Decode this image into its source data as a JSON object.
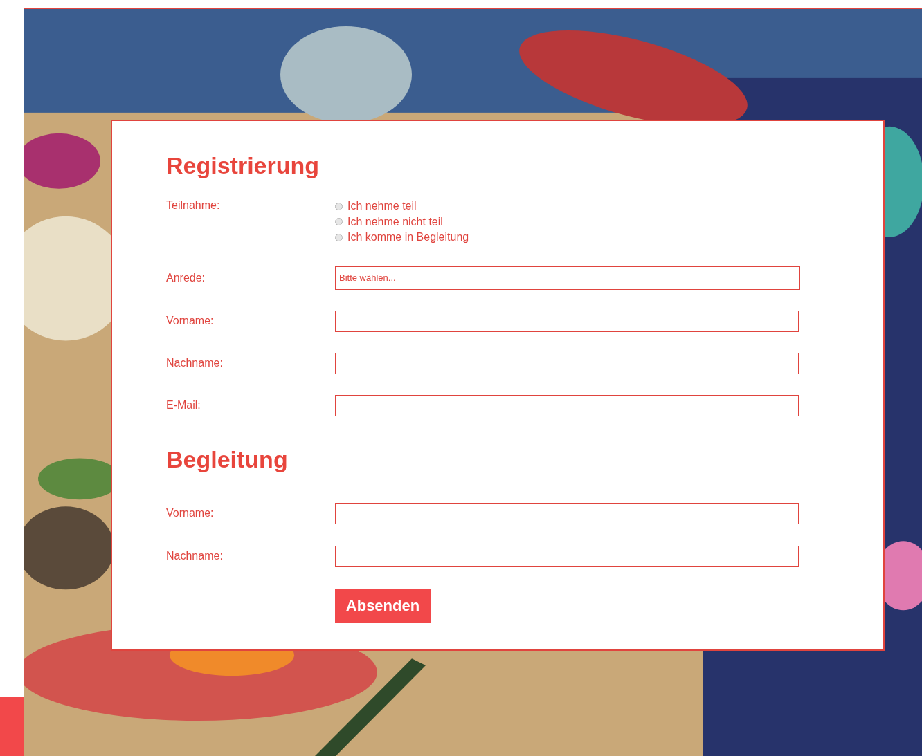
{
  "sections": [
    {
      "heading": "Registrierung",
      "fields": [
        {
          "kind": "radio",
          "label": "Teilnahme:",
          "options": [
            {
              "label": "Ich nehme teil",
              "selected": false
            },
            {
              "label": "Ich nehme nicht teil",
              "selected": false
            },
            {
              "label": "Ich komme in Begleitung",
              "selected": false
            }
          ]
        },
        {
          "kind": "select",
          "label": "Anrede:",
          "placeholder": "Bitte wählen..."
        },
        {
          "kind": "text",
          "label": "Vorname:"
        },
        {
          "kind": "text",
          "label": "Nachname:"
        },
        {
          "kind": "text",
          "label": "E-Mail:"
        }
      ]
    },
    {
      "heading": "Begleitung",
      "fields": [
        {
          "kind": "text",
          "label": "Vorname:"
        },
        {
          "kind": "text",
          "label": "Nachname:"
        }
      ]
    }
  ],
  "submit": "Absenden"
}
